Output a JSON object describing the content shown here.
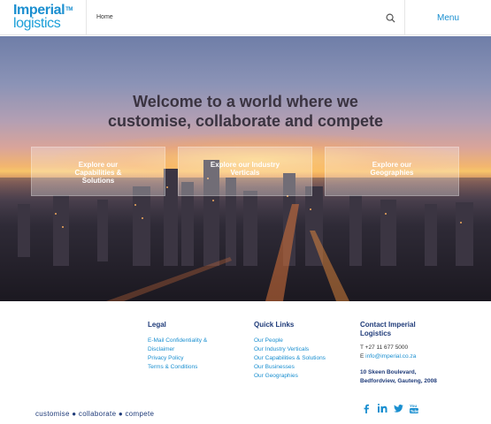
{
  "logo": {
    "line1": "Imperial",
    "line2": "logistics",
    "tm": "TM"
  },
  "nav": {
    "home": "Home",
    "menu": "Menu"
  },
  "hero": {
    "title_line1": "Welcome to a world where we",
    "title_line2": "customise, collaborate and compete",
    "cards": [
      {
        "label": "Explore our Capabilities & Solutions"
      },
      {
        "label": "Explore our Industry Verticals"
      },
      {
        "label": "Explore our Geographies"
      }
    ]
  },
  "footer": {
    "legal": {
      "heading": "Legal",
      "links": [
        "E-Mail Confidentiality &",
        "Disclaimer",
        "Privacy Policy",
        "Terms & Conditions"
      ]
    },
    "quick_links": {
      "heading": "Quick Links",
      "links": [
        "Our People",
        "Our Industry Verticals",
        "Our Capabilities & Solutions",
        "Our Businesses",
        "Our Geographies"
      ]
    },
    "contact": {
      "heading_line1": "Contact Imperial",
      "heading_line2": "Logistics",
      "phone": "T +27 11 677 5000",
      "email_prefix": "E",
      "email": "info@imperial.co.za",
      "address_line1": "10 Skeen Boulevard,",
      "address_line2": "Bedfordview, Gauteng, 2008"
    },
    "tagline": "customise ● collaborate ● compete",
    "social_icons": [
      "facebook-icon",
      "linkedin-icon",
      "twitter-icon",
      "youtube-icon"
    ]
  },
  "colors": {
    "brand_blue": "#1a8fd0",
    "navy": "#1f3b79"
  }
}
